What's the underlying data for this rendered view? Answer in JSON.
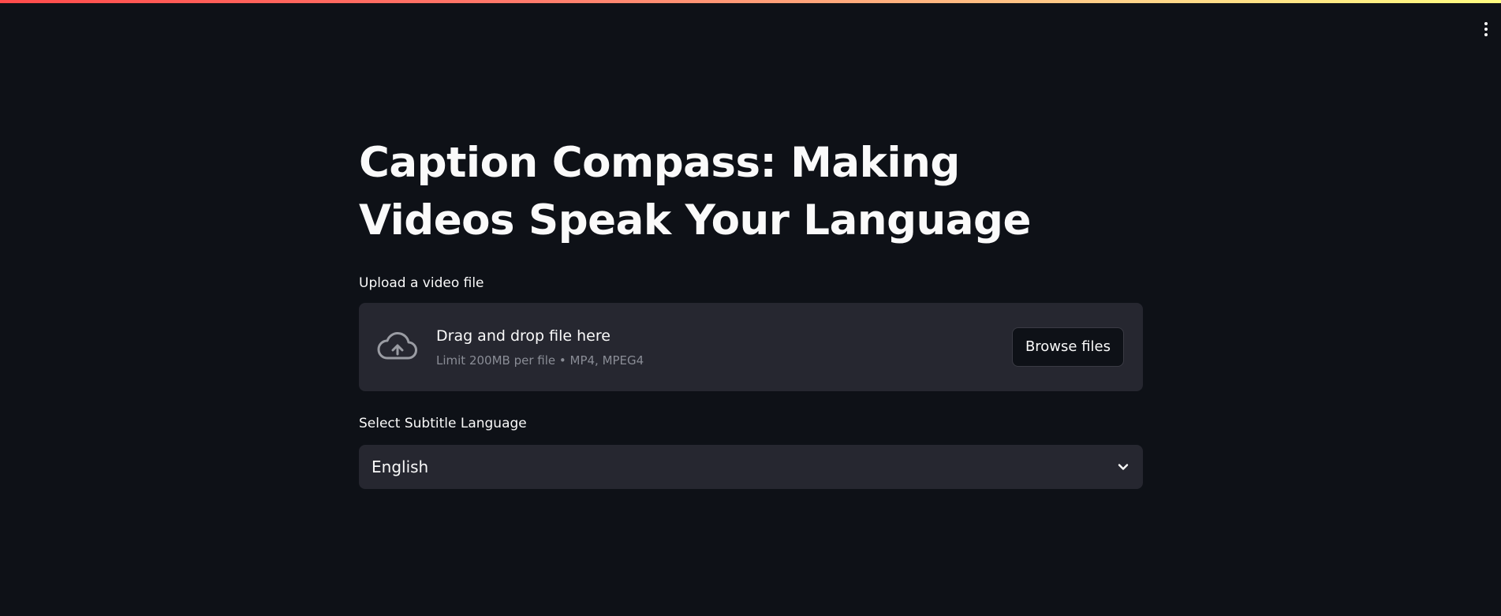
{
  "header": {
    "menu_icon": "vertical-ellipsis-icon"
  },
  "main": {
    "title": "Caption Compass: Making Videos Speak Your Language",
    "uploader": {
      "label": "Upload a video file",
      "icon": "cloud-upload-icon",
      "drag_text": "Drag and drop file here",
      "limit_text": "Limit 200MB per file • MP4, MPEG4",
      "browse_label": "Browse files"
    },
    "language_select": {
      "label": "Select Subtitle Language",
      "selected_value": "English",
      "icon": "chevron-down-icon"
    }
  },
  "colors": {
    "background": "#0e1117",
    "widget_background": "#262730",
    "text": "#fafafa",
    "muted_text": "#8a8d96",
    "accent_gradient_start": "#ff4b4b",
    "accent_gradient_end": "#fffd80"
  }
}
